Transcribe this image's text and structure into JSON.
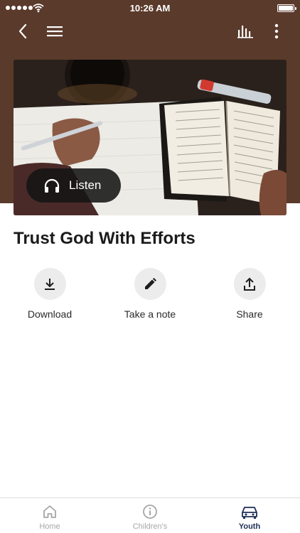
{
  "status_bar": {
    "time": "10:26 AM"
  },
  "nav": {
    "back_icon": "chevron-left-icon",
    "menu_icon": "hamburger-menu-icon",
    "equalizer_icon": "equalizer-icon",
    "more_icon": "more-vertical-icon"
  },
  "hero": {
    "image": "open bible, notebook, pen, coffee cup on wooden desk",
    "listen_label": "Listen",
    "listen_icon": "headphones-icon"
  },
  "sermon": {
    "title": "Trust God With Efforts"
  },
  "actions": [
    {
      "label": "Download",
      "icon": "download-icon"
    },
    {
      "label": "Take a note",
      "icon": "pencil-icon"
    },
    {
      "label": "Share",
      "icon": "share-icon"
    }
  ],
  "tab_bar": {
    "tabs": [
      {
        "label": "Home",
        "icon": "home-icon",
        "active": false
      },
      {
        "label": "Children's",
        "icon": "info-icon",
        "active": false
      },
      {
        "label": "Youth",
        "icon": "car-icon",
        "active": true
      }
    ]
  },
  "colors": {
    "header_bg": "#5a3a2b",
    "active_tab": "#1f2f56",
    "inactive_tab": "#a6a6a6",
    "action_circle": "#ececec"
  }
}
